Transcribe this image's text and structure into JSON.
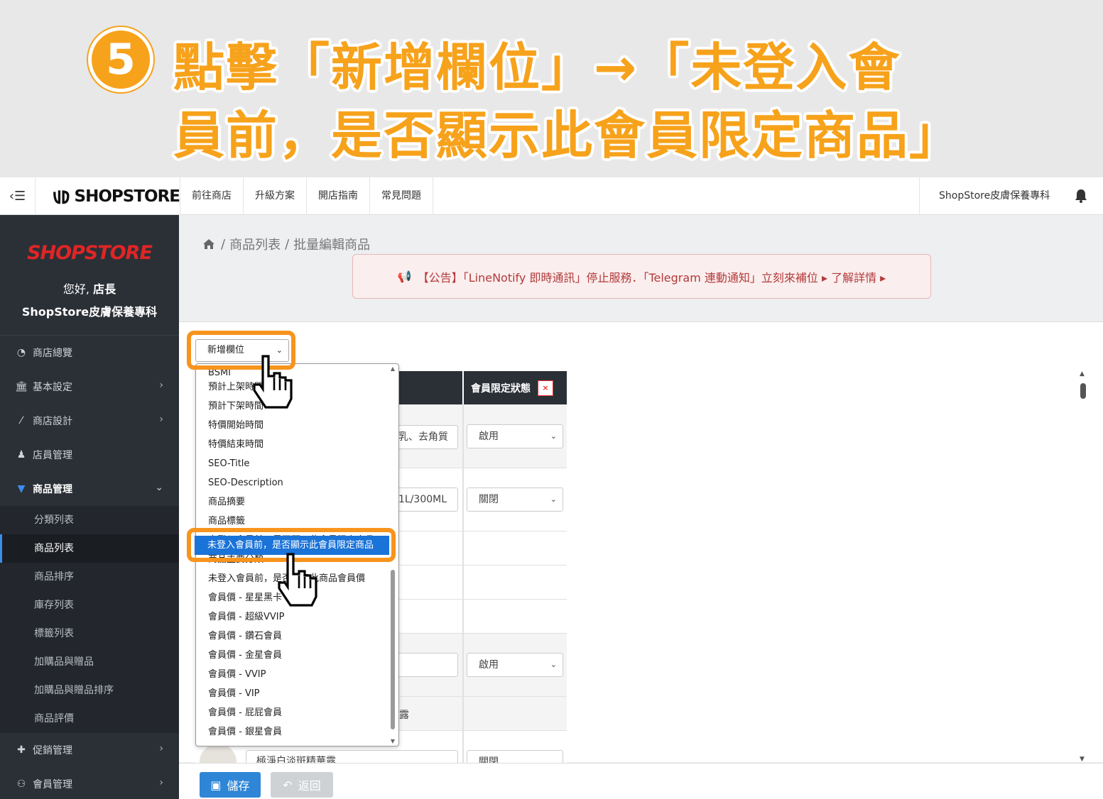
{
  "banner": {
    "step_number": "5",
    "line1": "點擊「新增欄位」→「未登入會",
    "line2": "員前，是否顯示此會員限定商品」"
  },
  "topbar": {
    "logo_text": "SHOPSTORE",
    "nav": [
      "前往商店",
      "升級方案",
      "開店指南",
      "常見問題"
    ],
    "store_name": "ShopStore皮膚保養專科"
  },
  "sidebar": {
    "logo_text": "SHOPSTORE",
    "greeting": "您好,",
    "greeting_role": "店長",
    "store_name": "ShopStore皮膚保養專科",
    "items": [
      {
        "label": "商店總覽",
        "icon": "dashboard-icon"
      },
      {
        "label": "基本設定",
        "icon": "bank-icon"
      },
      {
        "label": "商店設計",
        "icon": "magic-wand-icon"
      },
      {
        "label": "店員管理",
        "icon": "user-icon"
      },
      {
        "label": "商品管理",
        "icon": "cart-icon"
      }
    ],
    "sub_items": [
      "分類列表",
      "商品列表",
      "商品排序",
      "庫存列表",
      "標籤列表",
      "加購品與贈品",
      "加購品與贈品排序",
      "商品評價"
    ],
    "bottom_items": [
      {
        "label": "促銷管理",
        "icon": "gift-icon"
      },
      {
        "label": "會員管理",
        "icon": "users-icon"
      }
    ]
  },
  "breadcrumb": {
    "sep": "/",
    "items": [
      "商品列表",
      "批量編輯商品"
    ]
  },
  "notice": {
    "text": "【公告】「LineNotify 即時通訊」停止服務．「Telegram 連動通知」立刻來補位 ▸ 了解詳情 ▸"
  },
  "add_column": {
    "value": "新增欄位"
  },
  "dropdown": {
    "items": [
      "BSMI",
      "預計上架時間",
      "預計下架時間",
      "特價開始時間",
      "特價結束時間",
      "SEO-Title",
      "SEO-Description",
      "商品摘要",
      "商品標籤",
      "未登入會員前，是否顯示此會員限定商品",
      "商品主要分類",
      "未登入會員前，是否顯示此商品會員價",
      "會員價 - 星星黑卡",
      "會員價 - 超級VVIP",
      "會員價 - 鑽石會員",
      "會員價 - 金星會員",
      "會員價 - VVIP",
      "會員價 - VIP",
      "會員價 - 屁屁會員",
      "會員價 - 銀星會員"
    ],
    "selected": "未登入會員前，是否顯示此會員限定商品"
  },
  "table": {
    "col_header": "會員限定狀態",
    "remove_label": "×",
    "rows": [
      {
        "text": "乳、去角質",
        "status": "啟用"
      },
      {
        "text": "1L/300ML",
        "status": "關閉"
      },
      {
        "text": "",
        "status": "啟用"
      },
      {
        "text": "露",
        "status": ""
      },
      {
        "text": "極淨白淡斑精華露",
        "status": "關閉"
      }
    ]
  },
  "buttons": {
    "save": "儲存",
    "back": "返回"
  }
}
